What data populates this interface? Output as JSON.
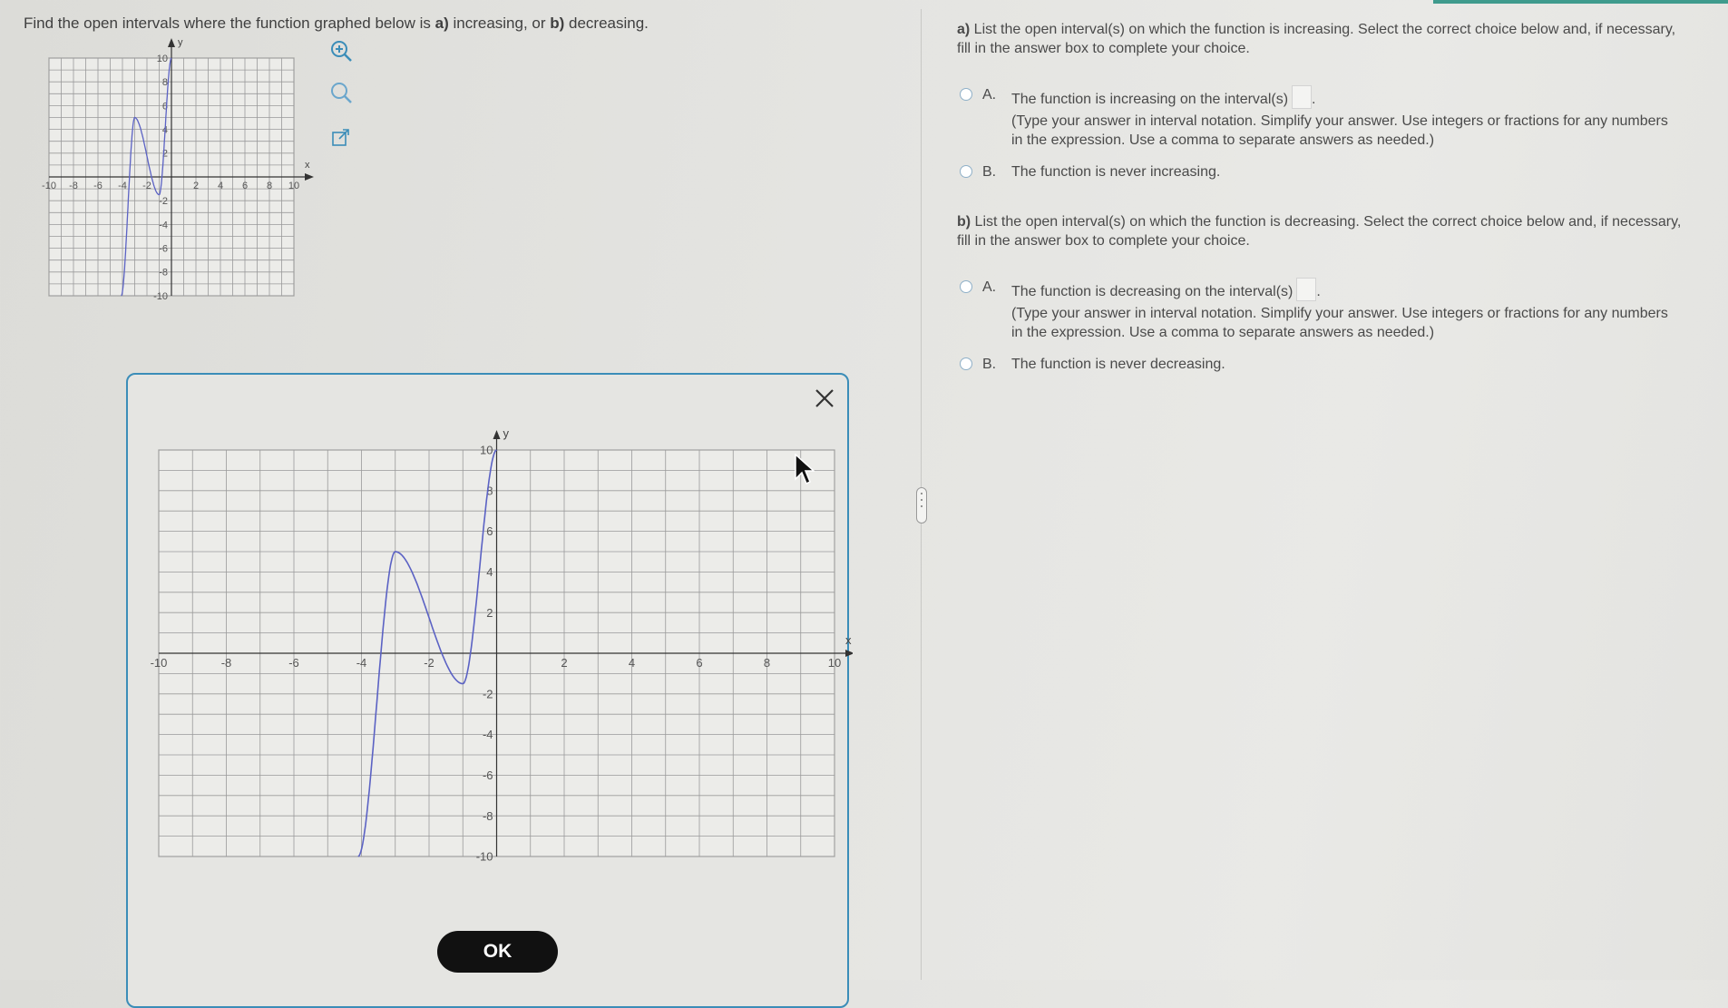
{
  "question": {
    "prompt_parts": [
      "Find the open intervals where the function graphed below is ",
      "a)",
      " increasing, or ",
      "b)",
      " decreasing."
    ]
  },
  "graph": {
    "x_label": "x",
    "y_label": "y",
    "x_range": [
      -10,
      10
    ],
    "y_range": [
      -10,
      10
    ],
    "grid_step": 1,
    "x_ticks": [
      "-10",
      "-8",
      "-6",
      "-4",
      "-2",
      "2",
      "4",
      "6",
      "8",
      "10"
    ],
    "y_ticks": [
      "10",
      "8",
      "6",
      "4",
      "2",
      "-2",
      "-4",
      "-6",
      "-8",
      "-10"
    ],
    "curve_points": [
      [
        -4.1,
        -10
      ],
      [
        -3,
        5
      ],
      [
        -1,
        -1.5
      ],
      [
        0,
        10
      ]
    ],
    "curve_color": "#5b62c4"
  },
  "tools": {
    "zoom_in": "zoom-in-icon",
    "zoom_out": "zoom-out-icon",
    "popout": "external-link-icon"
  },
  "part_a": {
    "label": "a)",
    "text": " List the open interval(s) on which the function is increasing. Select the correct choice below and, if necessary, fill in the answer box to complete your choice.",
    "choice_a_letter": "A.",
    "choice_a_text": "The function is increasing on the interval(s)",
    "choice_a_hint": "(Type your answer in interval notation. Simplify your answer. Use integers or fractions for any numbers in the expression. Use a comma to separate answers as needed.)",
    "choice_b_letter": "B.",
    "choice_b_text": "The function is never increasing."
  },
  "part_b": {
    "label": "b)",
    "text": " List the open interval(s) on which the function is decreasing. Select the correct choice below and, if necessary, fill in the answer box to complete your choice.",
    "choice_a_letter": "A.",
    "choice_a_text": "The function is decreasing on the interval(s)",
    "choice_a_hint": "(Type your answer in interval notation. Simplify your answer. Use integers or fractions for any numbers in the expression. Use a comma to separate answers as needed.)",
    "choice_b_letter": "B.",
    "choice_b_text": "The function is never decreasing."
  },
  "modal": {
    "ok_label": "OK",
    "accent": "#3b8db8"
  }
}
